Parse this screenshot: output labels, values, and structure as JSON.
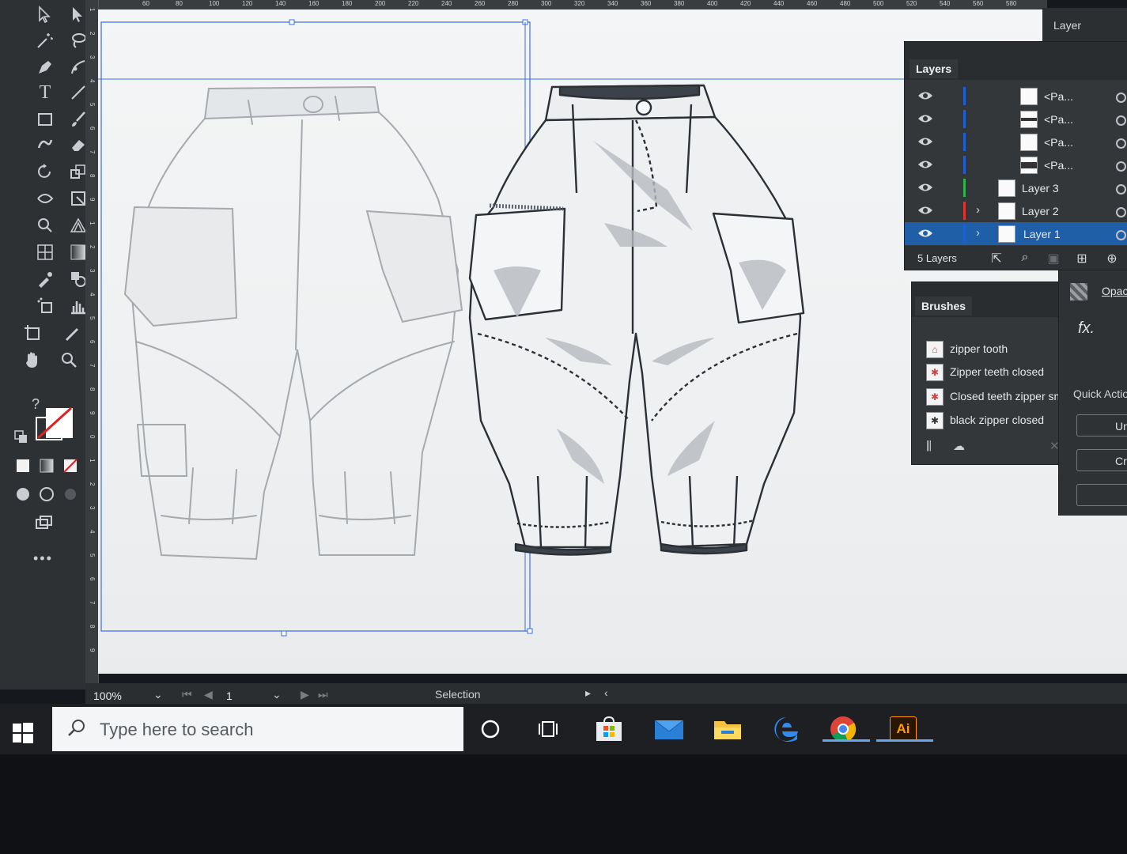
{
  "statusbar": {
    "zoom": "100%",
    "artboard_number": "1",
    "tool_name": "Selection"
  },
  "rulers": {
    "top_ticks": [
      "60",
      "80",
      "100",
      "120",
      "140",
      "160",
      "180",
      "200",
      "220",
      "240",
      "260",
      "280",
      "300",
      "320",
      "340",
      "360",
      "380",
      "400",
      "420",
      "440",
      "460",
      "480",
      "500",
      "520",
      "540",
      "560",
      "580"
    ],
    "left_ticks": [
      "1",
      "2",
      "3",
      "4",
      "5",
      "6",
      "7",
      "8",
      "9",
      "1",
      "2",
      "3",
      "4",
      "5",
      "6",
      "7",
      "8",
      "9",
      "0",
      "1",
      "2",
      "3",
      "4",
      "5",
      "6",
      "7",
      "8",
      "9"
    ]
  },
  "panels": {
    "layer_tab": "Layer",
    "layers": {
      "title": "Layers",
      "rows": [
        {
          "name": "<Pa...",
          "color": "#1f5fd6",
          "kind": "path"
        },
        {
          "name": "<Pa...",
          "color": "#1f5fd6",
          "kind": "path"
        },
        {
          "name": "<Pa...",
          "color": "#1f5fd6",
          "kind": "path"
        },
        {
          "name": "<Pa...",
          "color": "#1f5fd6",
          "kind": "path"
        },
        {
          "name": "Layer 3",
          "color": "#2fb34a",
          "kind": "layer"
        },
        {
          "name": "Layer 2",
          "color": "#e2332f",
          "kind": "layer"
        },
        {
          "name": "Layer 1",
          "color": "#1f5fd6",
          "kind": "layer",
          "selected": true
        }
      ],
      "count": "5 Layers"
    },
    "brushes": {
      "title": "Brushes",
      "items": [
        "zipper tooth",
        "Zipper teeth closed",
        "Closed teeth zipper sm",
        "black zipper closed"
      ]
    },
    "properties": {
      "opacity_label": "Opac",
      "fx_label": "fx.",
      "quick_actions": "Quick Actio",
      "button1": "Un",
      "button2": "Cro"
    }
  },
  "taskbar": {
    "search_placeholder": "Type here to search",
    "accent": "#6aa7e8"
  },
  "colors": {
    "selection_guide": "#3b6fd8",
    "illustrator_orange": "#ff9a00"
  }
}
